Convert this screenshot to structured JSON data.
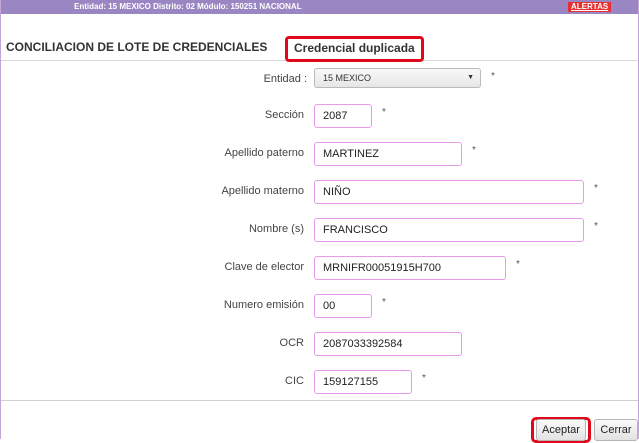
{
  "header": {
    "info": "Entidad: 15 MEXICO Distrito: 02 Módulo: 150251 NACIONAL",
    "alerts_label": "ALERTAS"
  },
  "title": {
    "main": "CONCILIACION DE LOTE DE CREDENCIALES",
    "status": "Credencial duplicada"
  },
  "required_mark": "*",
  "form": {
    "entidad": {
      "label": "Entidad :",
      "value": "15 MEXICO"
    },
    "seccion": {
      "label": "Sección",
      "value": "2087"
    },
    "apellido_paterno": {
      "label": "Apellido paterno",
      "value": "MARTINEZ"
    },
    "apellido_materno": {
      "label": "Apellido materno",
      "value": "NIÑO"
    },
    "nombre": {
      "label": "Nombre (s)",
      "value": "FRANCISCO"
    },
    "clave_elector": {
      "label": "Clave de elector",
      "value": "MRNIFR00051915H700"
    },
    "numero_emision": {
      "label": "Numero emisión",
      "value": "00"
    },
    "ocr": {
      "label": "OCR",
      "value": "2087033392584"
    },
    "cic": {
      "label": "CIC",
      "value": "159127155"
    }
  },
  "buttons": {
    "accept": "Aceptar",
    "close": "Cerrar"
  },
  "colors": {
    "header_bg": "#9b86c4",
    "alert_bg": "#e43030",
    "highlight": "#e0081b",
    "field_border": "#e89be8"
  }
}
